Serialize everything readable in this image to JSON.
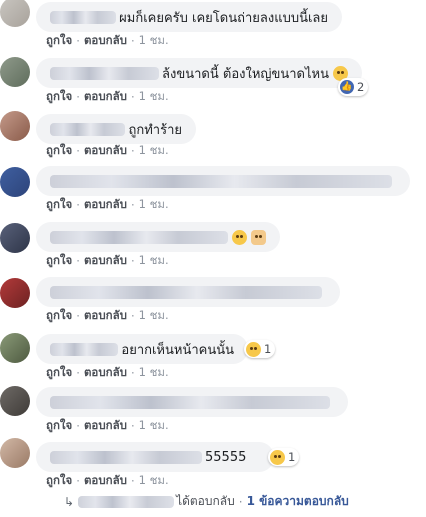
{
  "comments": [
    {
      "text": "ผมก็เคยครับ เคยโดนถ่ายลงแบบนี้เลย",
      "avatar_colors": [
        "#c9c6c1",
        "#a8a29b"
      ],
      "actions": {
        "like": "ถูกใจ",
        "reply": "ตอบกลับ",
        "time": "1 ชม."
      }
    },
    {
      "text": "ล้งขนาดนี้ ต้องใหญ่ขนาดไหน",
      "emoji": "laughing-emoji-icon",
      "reaction": {
        "icon": "like-icon",
        "count": "2"
      },
      "avatar_colors": [
        "#8f9a8b",
        "#5f6d5c"
      ],
      "actions": {
        "like": "ถูกใจ",
        "reply": "ตอบกลับ",
        "time": "1 ชม."
      }
    },
    {
      "text": "ถูกทำร้าย",
      "avatar_colors": [
        "#c49a8a",
        "#8a5b4a"
      ],
      "actions": {
        "like": "ถูกใจ",
        "reply": "ตอบกลับ",
        "time": "1 ชม."
      }
    },
    {
      "text": "",
      "avatar_colors": [
        "#3f5fa0",
        "#2d447a"
      ],
      "actions": {
        "like": "ถูกใจ",
        "reply": "ตอบกลับ",
        "time": "1 ชม."
      }
    },
    {
      "text": "",
      "emoji": "thinking-emoji-icon",
      "emoji2": "folded-hands-icon",
      "avatar_colors": [
        "#2e3548",
        "#59617a"
      ],
      "actions": {
        "like": "ถูกใจ",
        "reply": "ตอบกลับ",
        "time": "1 ชม."
      }
    },
    {
      "text": "",
      "avatar_colors": [
        "#b33a3a",
        "#6d2222"
      ],
      "actions": {
        "like": "ถูกใจ",
        "reply": "ตอบกลับ",
        "time": "1 ชม."
      }
    },
    {
      "text": "อยากเห็นหน้าคนนั้น",
      "emoji": "crying-emoji-icon",
      "reaction_count": "1",
      "avatar_colors": [
        "#8a9a78",
        "#4e5a40"
      ],
      "actions": {
        "like": "ถูกใจ",
        "reply": "ตอบกลับ",
        "time": "1 ชม."
      }
    },
    {
      "text": "",
      "avatar_colors": [
        "#6e6a66",
        "#3f3b38"
      ],
      "actions": {
        "like": "ถูกใจ",
        "reply": "ตอบกลับ",
        "time": "1 ชม."
      }
    },
    {
      "text": "55555",
      "emoji": "laughing-emoji-icon",
      "reaction_count": "1",
      "avatar_colors": [
        "#d2b8a6",
        "#9a7a66"
      ],
      "actions": {
        "like": "ถูกใจ",
        "reply": "ตอบกลับ",
        "time": "1 ชม."
      }
    }
  ],
  "reply_summary": {
    "replied": "ได้ตอบกลับ",
    "count_text": "1 ข้อความตอบกลับ"
  }
}
